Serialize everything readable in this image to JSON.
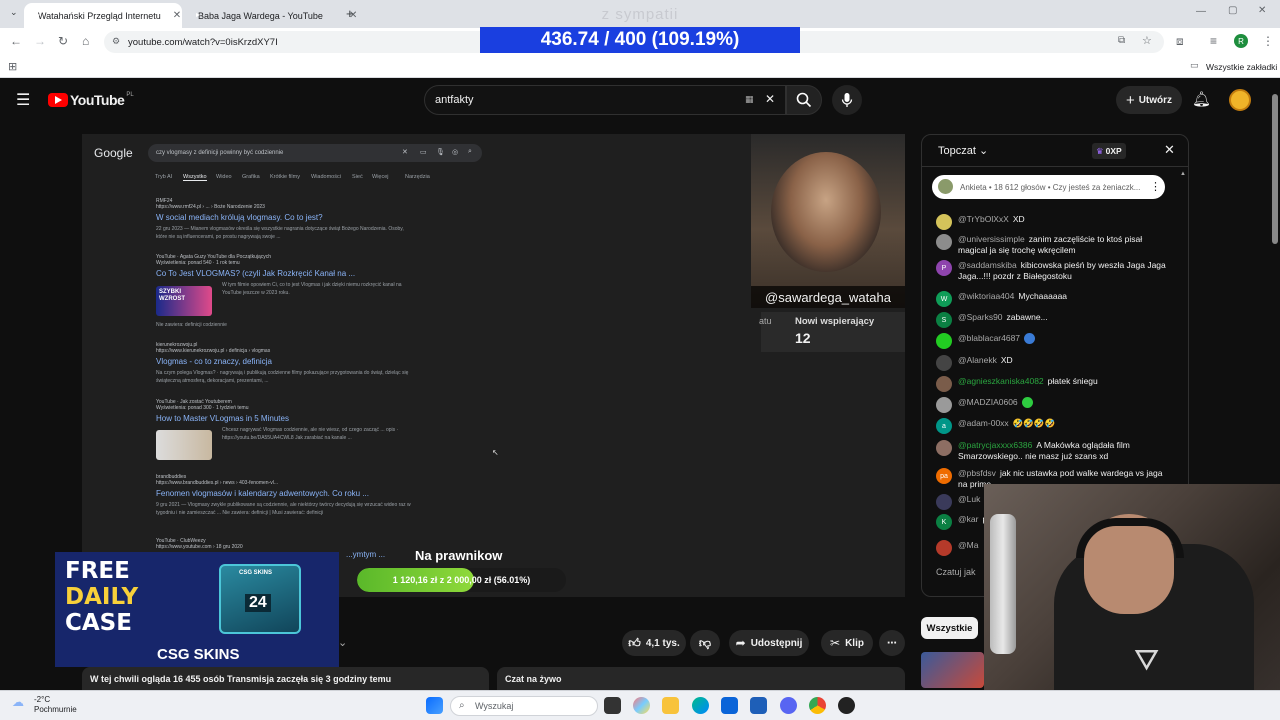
{
  "browser": {
    "tabs": [
      {
        "title": "Watahański Przegląd Internetu",
        "active": true
      },
      {
        "title": "Baba Jaga Wardega - YouTube",
        "active": false
      }
    ],
    "new_tab": "+",
    "url": "youtube.com/watch?v=0isKrzdXY7I",
    "bookmarks_label": "Wszystkie zakładki",
    "profile_initial": "R"
  },
  "overlay": {
    "sympatii": "z sympatii",
    "counter": "436.74 / 400 (109.19%)"
  },
  "youtube": {
    "logo": "YouTube",
    "region": "PL",
    "search_value": "antfakty",
    "create_label": "Utwórz"
  },
  "player": {
    "google": {
      "logo": "Google",
      "query": "czy vlogmasy z definicji powinny być codziennie",
      "nav": [
        "Tryb AI",
        "Wszystko",
        "Wideo",
        "Grafika",
        "Krótkie filmy",
        "Wiadomości",
        "Sieć",
        "Więcej",
        "Narzędzia"
      ],
      "results": [
        {
          "source": "RMF24",
          "url": "https://www.rmf24.pl › ... › Boże Narodzenie 2023",
          "title": "W social mediach królują vlogmasy. Co to jest?",
          "snippet": "22 gru 2023 — Mianem vlogmasów określa się wszystkie nagrania dotyczące świąt Bożego Narodzenia. Osoby, które nie są influencerami, po prostu nagrywają swoje ..."
        },
        {
          "source": "YouTube · Agata Guzy YouTube dla Początkujących",
          "url": "Wyświetlenia: ponad 540 · 1 rok temu",
          "title": "Co To Jest VLOGMAS? (czyli Jak Rozkręcić Kanał na ...",
          "snippet": "W tym filmie opowiem Ci, co to jest Vlogmas i jak dzięki niemu rozkręcić kanał na YouTube jeszcze w 2023 roku."
        },
        {
          "source": "kierunekrozwoju.pl",
          "url": "https://www.kierunekrozwoju.pl › definicja › vlogmas",
          "title": "Vlogmas - co to znaczy, definicja",
          "snippet": "Na czym polega Vlogmas? · nagrywają i publikują codzienne filmy pokazujące przygotowania do świąt, dzieląc się świąteczną atmosferą, dekoracjami, prezentami, ..."
        },
        {
          "source": "YouTube · Jak zostać Youtuberem",
          "url": "Wyświetlenia: ponad 300 · 1 tydzień temu",
          "title": "How to Master VLogmas in 5 Minutes",
          "snippet": "Chcesz nagrywać Vlogmas codziennie, ale nie wiesz, od czego zacząć ... opis · https://youtu.be/DA55UA4CWL8 Jak zarabiać na kanale ..."
        },
        {
          "source": "brandbuddies",
          "url": "https://www.brandbuddies.pl › news › 403-fenomen-vl...",
          "title": "Fenomen vlogmasów i kalendarzy adwentowych. Co roku ...",
          "snippet": "9 gru 2021 — Vlogmasy zwykle publikowane są codziennie, ale niektórzy twórcy decydują się wrzucać wideo raz w tygodniu i nie zamieszczać ... Nie zawiera: definicji | Musi zawierać: definicji"
        },
        {
          "source": "YouTube · ClubWeezy",
          "url": "https://www.youtube.com › 18 gru 2020",
          "title": "...ymtym ...",
          "snippet": ""
        }
      ],
      "thumb_label_1": "SZYBKI WZROST",
      "no_contains": "Nie zawiera: definicji codziennie"
    },
    "camera_handle": "@sawardega_wataha",
    "supporters": {
      "left_label": "atu",
      "label": "Nowi wspierający",
      "value": "12"
    },
    "goal": {
      "title": "Na prawnikow",
      "text": "1 120,16 zł z 2 000,00 zł (56.01%)",
      "fraction": 0.5601
    }
  },
  "ad": {
    "lines": [
      "FREE",
      "DAILY",
      "CASE"
    ],
    "brand": "CSG SKINS",
    "case_label": "CSG SKINS",
    "case_number": "24"
  },
  "actions": {
    "likes": "4,1 tys.",
    "share": "Udostępnij",
    "clip": "Klip"
  },
  "info": {
    "watching": "W tej chwili ogląda 16 455 osób  Transmisja zaczęła się 3 godziny temu",
    "live_chat": "Czat na żywo"
  },
  "chat": {
    "mode": "Topczat",
    "points": "0XP",
    "poll": "Ankieta • 18 612 głosów • Czy jesteś za żeniaczk...",
    "input_placeholder": "Czatuj jak",
    "messages": [
      {
        "user": "@TrYbOlXxX",
        "text": "XD",
        "color": "#d4c35a"
      },
      {
        "user": "@universissimple",
        "text": "zanim zaczęliście to ktoś pisał magical ja się trochę wkręcilem",
        "color": "#8c8c8c"
      },
      {
        "user": "@saddamskiba",
        "text": "kibicowska pieśń by weszła Jaga Jaga Jaga...!!! pozdr z Białegostoku",
        "color": "#8e44ad",
        "initial": "P"
      },
      {
        "user": "@wiktoriaa404",
        "text": "Mychaaaaaa",
        "color": "#0f9d58",
        "initial": "W"
      },
      {
        "user": "@Sparks90",
        "text": "zabawne...",
        "color": "#0b8043",
        "initial": "S"
      },
      {
        "user": "@blablacar4687",
        "text": "",
        "color": "#22cc22",
        "emoji": true
      },
      {
        "user": "@Alanekk",
        "text": "XD",
        "color": "#444"
      },
      {
        "user": "@agnieszkaniska4082",
        "text": "płatek śniegu",
        "color": "#7a5c4a",
        "green": true
      },
      {
        "user": "@MADZIA0606",
        "text": "",
        "color": "#9a9a9a",
        "emoji": true
      },
      {
        "user": "@adam-00xx",
        "text": "🤣🤣🤣🤣",
        "color": "#009688",
        "initial": "a"
      },
      {
        "user": "@patrycjaxxxx6386",
        "text": "A Makówka oglądała film Smarzowskiego.. nie masz już szans xd",
        "color": "#8d6e63",
        "green": true
      },
      {
        "user": "@pbsfdsv",
        "text": "jak nic ustawka pod walke wardega vs jaga na prime",
        "color": "#ef6c00",
        "initial": "pa"
      },
      {
        "user": "@Luk",
        "text": "",
        "color": "#3a3a5a"
      },
      {
        "user": "@kar",
        "text": "poma",
        "color": "#0b8043",
        "initial": "K"
      },
      {
        "user": "@Ma",
        "text": "",
        "color": "#b53a2a"
      }
    ],
    "filter_chip": "Wszystkie"
  },
  "taskbar": {
    "temp": "-2°C",
    "weather": "Pochmurnie",
    "search": "Wyszukaj"
  }
}
